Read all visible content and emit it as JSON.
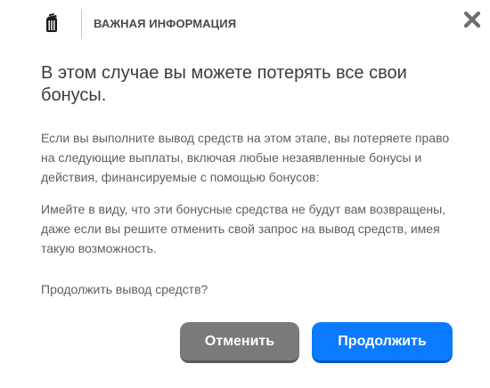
{
  "header": {
    "logo_icon": "trash-bin-icon",
    "title": "ВАЖНАЯ ИНФОРМАЦИЯ",
    "close_icon": "close-x-icon"
  },
  "body": {
    "headline": "В этом случае вы можете потерять все свои бонусы.",
    "paragraph_1": "Если вы выполните вывод средств на этом этапе, вы потеряете право на следующие выплаты, включая любые незаявленные бонусы и действия, финансируемые с помощью бонусов:",
    "paragraph_2": "Имейте в виду, что эти бонусные средства не будут вам возвращены, даже если вы решите отменить свой запрос на вывод средств, имея такую возможность.",
    "question": "Продолжить вывод средств?"
  },
  "buttons": {
    "cancel_label": "Отменить",
    "continue_label": "Продолжить"
  },
  "colors": {
    "cancel_button": "#7a7a7a",
    "continue_button": "#0a7bff",
    "close_icon": "#6e6e6e"
  }
}
